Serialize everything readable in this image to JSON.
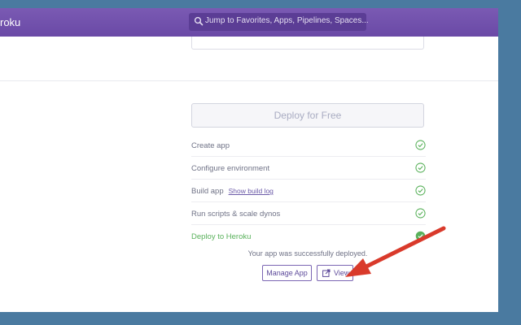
{
  "header": {
    "brand": "roku",
    "search_placeholder": "Jump to Favorites, Apps, Pipelines, Spaces..."
  },
  "deploy": {
    "button_label": "Deploy for Free",
    "steps": [
      {
        "label": "Create app",
        "link": ""
      },
      {
        "label": "Configure environment",
        "link": ""
      },
      {
        "label": "Build app",
        "link": "Show build log"
      },
      {
        "label": "Run scripts & scale dynos",
        "link": ""
      },
      {
        "label": "Deploy to Heroku",
        "link": ""
      }
    ],
    "success_message": "Your app was successfully deployed.",
    "manage_label": "Manage App",
    "view_label": "View"
  },
  "colors": {
    "header": "#6a49a6",
    "success": "#59b15b",
    "arrow": "#d93a2b",
    "desktop": "#4a7aa0"
  },
  "icons": [
    "search-icon",
    "check-circle-icon",
    "external-link-icon",
    "arrow-annotation"
  ]
}
